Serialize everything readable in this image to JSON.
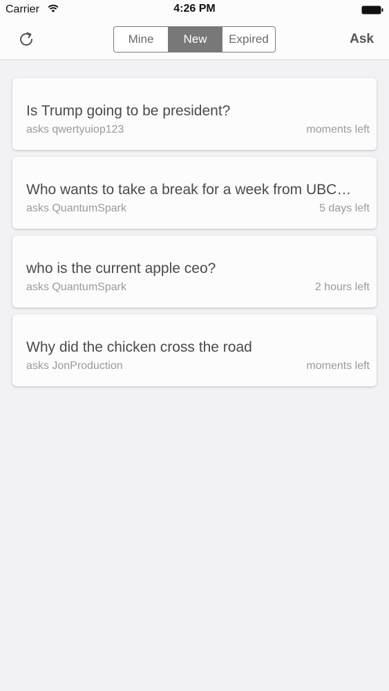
{
  "status_bar": {
    "carrier": "Carrier",
    "time": "4:26 PM"
  },
  "nav": {
    "refresh_icon": "refresh-icon",
    "tabs": [
      {
        "label": "Mine",
        "active": false
      },
      {
        "label": "New",
        "active": true
      },
      {
        "label": "Expired",
        "active": false
      }
    ],
    "ask_label": "Ask"
  },
  "questions": [
    {
      "title": "Is Trump going to be president?",
      "author": "asks qwertyuiop123",
      "time_left": "moments left"
    },
    {
      "title": "Who wants to take a break for a week from UBC…",
      "author": "asks QuantumSpark",
      "time_left": "5 days left"
    },
    {
      "title": "who is the current apple ceo?",
      "author": "asks QuantumSpark",
      "time_left": "2 hours left"
    },
    {
      "title": "Why did the chicken cross the road",
      "author": "asks JonProduction",
      "time_left": "moments left"
    }
  ],
  "colors": {
    "background": "#f2f1f4",
    "card": "#fdfcfd",
    "active_tab": "#787878"
  }
}
